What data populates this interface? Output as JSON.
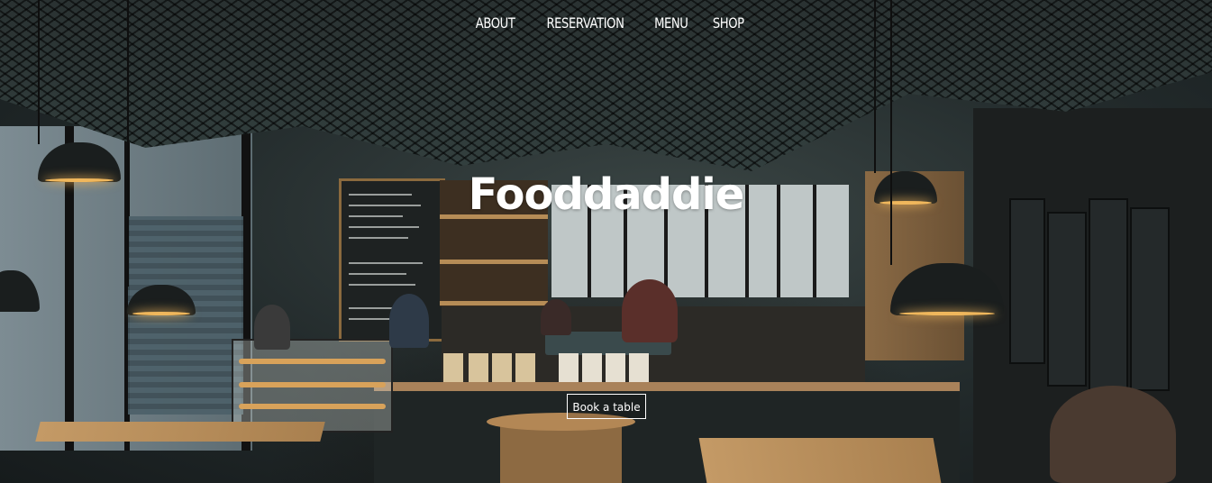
{
  "nav": {
    "items": [
      "ABOUT",
      "RESERVATION",
      "MENU",
      "SHOP"
    ]
  },
  "hero": {
    "brand": "Fooddaddie",
    "cta_label": "Book a table",
    "background": "cafe-interior-photo"
  },
  "colors": {
    "overlay_text": "#ffffff",
    "wood": "#b68c56",
    "lamp_glow": "#f0b75c"
  }
}
